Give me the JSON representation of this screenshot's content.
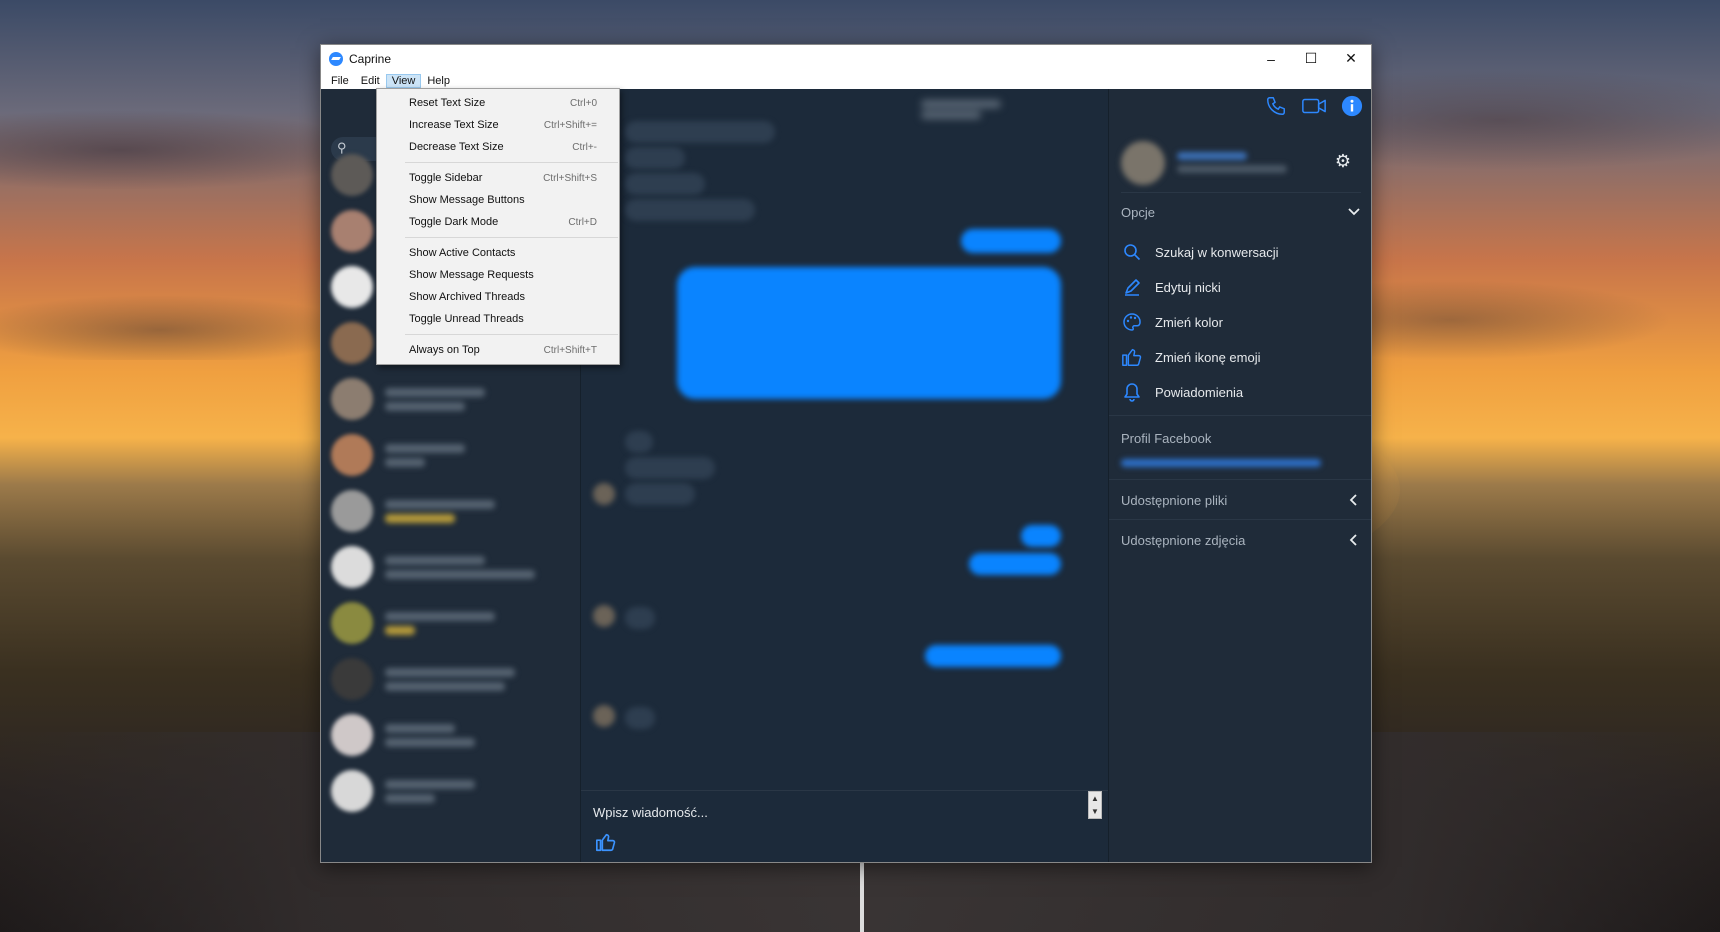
{
  "window": {
    "title": "Caprine",
    "controls": {
      "minimize": "–",
      "maximize": "☐",
      "close": "✕"
    }
  },
  "menubar": {
    "items": [
      "File",
      "Edit",
      "View",
      "Help"
    ],
    "active": "View"
  },
  "view_menu": {
    "groups": [
      [
        {
          "label": "Reset Text Size",
          "shortcut": "Ctrl+0"
        },
        {
          "label": "Increase Text Size",
          "shortcut": "Ctrl+Shift+="
        },
        {
          "label": "Decrease Text Size",
          "shortcut": "Ctrl+-"
        }
      ],
      [
        {
          "label": "Toggle Sidebar",
          "shortcut": "Ctrl+Shift+S"
        },
        {
          "label": "Show Message Buttons",
          "shortcut": ""
        },
        {
          "label": "Toggle Dark Mode",
          "shortcut": "Ctrl+D"
        }
      ],
      [
        {
          "label": "Show Active Contacts",
          "shortcut": ""
        },
        {
          "label": "Show Message Requests",
          "shortcut": ""
        },
        {
          "label": "Show Archived Threads",
          "shortcut": ""
        },
        {
          "label": "Toggle Unread Threads",
          "shortcut": ""
        }
      ],
      [
        {
          "label": "Always on Top",
          "shortcut": "Ctrl+Shift+T"
        }
      ]
    ]
  },
  "sidebar": {
    "search_icon": "search-icon"
  },
  "compose": {
    "placeholder": "Wpisz wiadomość...",
    "like_icon": "thumbs-up-icon"
  },
  "info_panel": {
    "header_icons": [
      "phone-icon",
      "video-camera-icon",
      "info-icon"
    ],
    "settings_icon": "gear-icon",
    "options_section": "Opcje",
    "options": [
      {
        "label": "Szukaj w konwersacji",
        "icon": "search-icon"
      },
      {
        "label": "Edytuj nicki",
        "icon": "pencil-icon"
      },
      {
        "label": "Zmień kolor",
        "icon": "palette-icon"
      },
      {
        "label": "Zmień ikonę emoji",
        "icon": "thumbs-up-icon"
      },
      {
        "label": "Powiadomienia",
        "icon": "bell-icon"
      }
    ],
    "facebook_profile_label": "Profil Facebook",
    "shared_files": "Udostępnione pliki",
    "shared_photos": "Udostępnione zdjęcia"
  },
  "colors": {
    "accent": "#0a84ff",
    "app_bg": "#1c2a3a",
    "panel_bg": "#1f2b39",
    "icon_blue": "#2d88ff"
  }
}
